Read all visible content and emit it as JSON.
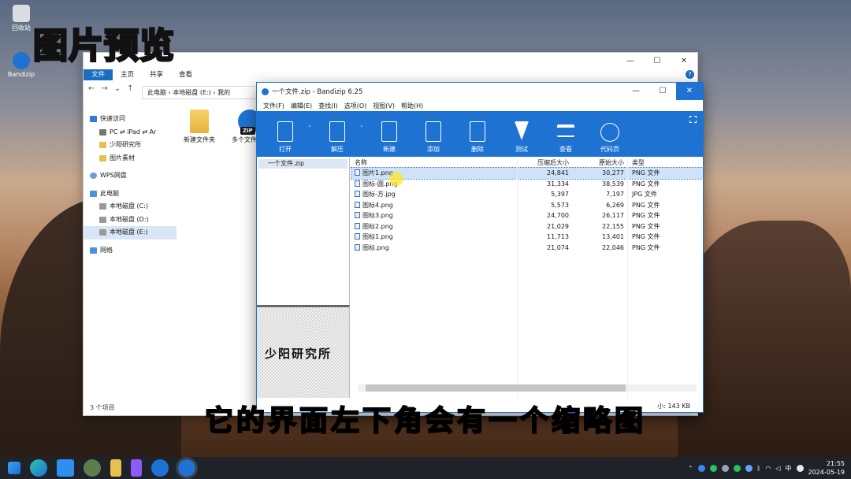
{
  "overlay": {
    "title": "图片预览",
    "subtitle": "它的界面左下角会有一个缩略图",
    "watermark": "少阳研究所"
  },
  "desktop": {
    "icons": [
      {
        "label": "回收站"
      },
      {
        "label": "Bandizip"
      }
    ]
  },
  "explorer": {
    "controls": [
      "—",
      "☐",
      "✕"
    ],
    "ribbon": [
      "文件",
      "主页",
      "共享",
      "查看"
    ],
    "address": "此电脑 › 本地磁盘 (E:) › 我的",
    "sidebar": [
      {
        "label": "快速访问",
        "indent": false
      },
      {
        "label": "PC ⇄ iPad ⇄ Ar",
        "indent": true
      },
      {
        "label": "少阳研究所",
        "indent": true
      },
      {
        "label": "图片素材",
        "indent": true
      },
      {
        "label": "WPS网盘",
        "indent": false
      },
      {
        "label": "此电脑",
        "indent": false
      },
      {
        "label": "本地磁盘 (C:)",
        "indent": true
      },
      {
        "label": "本地磁盘 (D:)",
        "indent": true
      },
      {
        "label": "本地磁盘 (E:)",
        "indent": true,
        "selected": true
      },
      {
        "label": "网络",
        "indent": false
      }
    ],
    "files": [
      {
        "label": "新建文件夹",
        "kind": "folder"
      },
      {
        "label": "多个文件.zip",
        "kind": "zip"
      }
    ],
    "status": "3 个项目"
  },
  "bandizip": {
    "title": "一个文件.zip - Bandizip 6.25",
    "menu": [
      "文件(F)",
      "编辑(E)",
      "查找(I)",
      "选项(O)",
      "视图(V)",
      "帮助(H)"
    ],
    "toolbar": [
      "打开",
      "解压",
      "新建",
      "添加",
      "删除",
      "测试",
      "查看",
      "代码页"
    ],
    "tree_root": "一个文件.zip",
    "columns": [
      "名称",
      "压缩后大小",
      "原始大小",
      "类型"
    ],
    "rows": [
      {
        "name": "图片1.png",
        "packed": "24,841",
        "size": "30,277",
        "type": "PNG 文件"
      },
      {
        "name": "图标-圆.png",
        "packed": "31,334",
        "size": "38,539",
        "type": "PNG 文件"
      },
      {
        "name": "图标-方.jpg",
        "packed": "5,397",
        "size": "7,197",
        "type": "JPG 文件"
      },
      {
        "name": "图标4.png",
        "packed": "5,573",
        "size": "6,269",
        "type": "PNG 文件"
      },
      {
        "name": "图标3.png",
        "packed": "24,700",
        "size": "26,117",
        "type": "PNG 文件"
      },
      {
        "name": "图标2.png",
        "packed": "21,029",
        "size": "22,155",
        "type": "PNG 文件"
      },
      {
        "name": "图标1.png",
        "packed": "11,713",
        "size": "13,401",
        "type": "PNG 文件"
      },
      {
        "name": "图标.png",
        "packed": "21,074",
        "size": "22,046",
        "type": "PNG 文件"
      }
    ],
    "status": "小: 143 KB"
  },
  "taskbar": {
    "lang": "中",
    "time": "21:55",
    "date": "2024-05-19"
  }
}
